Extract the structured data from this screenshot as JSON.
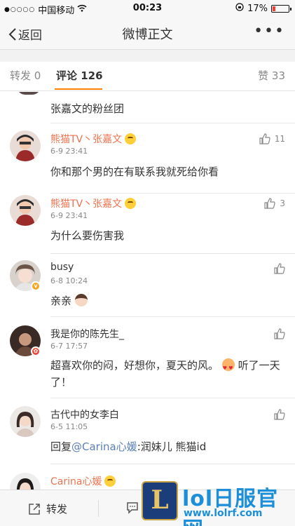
{
  "status_bar": {
    "carrier": "中国移动",
    "time": "00:23",
    "battery_percent": "17%",
    "battery_level": 0.17
  },
  "nav": {
    "back_label": "返回",
    "title": "微博正文"
  },
  "tabs": {
    "repost_label": "转发 0",
    "comments_label": "评论 126",
    "likes_label": "赞 33"
  },
  "partial_comment_text": "张嘉文的粉丝团",
  "comments": [
    {
      "name": "熊猫TV丶张嘉文",
      "time": "6-9 23:41",
      "likes": "11",
      "text": "你和那个男的在有联系我就死给你看"
    },
    {
      "name": "熊猫TV丶张嘉文",
      "time": "6-9 23:41",
      "likes": "3",
      "text": "为什么要伤害我"
    },
    {
      "name": "busy",
      "time": "6-8 10:24",
      "likes": "",
      "text": "亲亲"
    },
    {
      "name": "我是你的陈先生_",
      "time": "6-7 17:57",
      "likes": "",
      "text_a": "超喜欢你的闷，好想你，夏天的风。",
      "text_b": "听了一天了！"
    },
    {
      "name": "古代中的女李白",
      "time": "6-5 11:05",
      "likes": "",
      "reply_prefix": "回复",
      "mention": "@Carina心媛",
      "reply_rest": ":润妹儿 熊猫id"
    },
    {
      "name": "Carina心媛"
    }
  ],
  "bottom_bar": {
    "repost_label": "转发"
  },
  "watermark": {
    "logo_letter": "L",
    "title": "lol日服官网",
    "url": "www.lolrf.com"
  },
  "colors": {
    "accent": "#ff8200",
    "vip_name": "#eb7350",
    "mention": "#5a7fb5"
  }
}
